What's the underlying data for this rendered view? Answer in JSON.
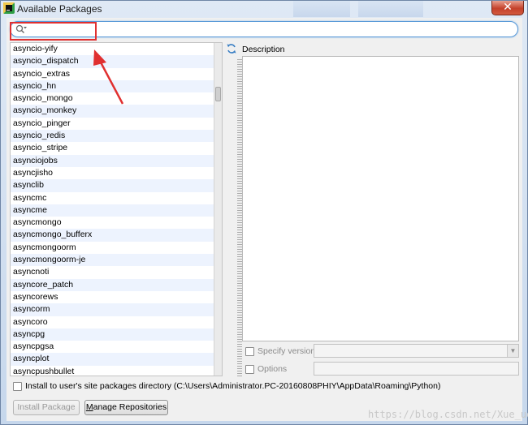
{
  "window": {
    "title": "Available Packages",
    "close_label": "✕"
  },
  "search": {
    "placeholder": "",
    "value": ""
  },
  "packages": [
    "asyncio-yify",
    "asyncio_dispatch",
    "asyncio_extras",
    "asyncio_hn",
    "asyncio_mongo",
    "asyncio_monkey",
    "asyncio_pinger",
    "asyncio_redis",
    "asyncio_stripe",
    "asynciojobs",
    "asyncjisho",
    "asynclib",
    "asyncmc",
    "asyncme",
    "asyncmongo",
    "asyncmongo_bufferx",
    "asyncmongoorm",
    "asyncmongoorm-je",
    "asyncnoti",
    "asyncore_patch",
    "asyncorews",
    "asyncorm",
    "asyncoro",
    "asyncpg",
    "asyncpgsa",
    "asyncplot",
    "asyncpushbullet"
  ],
  "description": {
    "label": "Description",
    "text": ""
  },
  "options": {
    "specify_version_label": "Specify version",
    "specify_version_checked": false,
    "options_label": "Options",
    "options_checked": false
  },
  "install_to_user": {
    "label": "Install to user's site packages directory (C:\\Users\\Administrator.PC-20160808PHIY\\AppData\\Roaming\\Python)",
    "checked": false
  },
  "buttons": {
    "install": "Install Package",
    "manage": "Manage Repositories"
  },
  "watermark": "https://blog.csdn.net/Xue_ue",
  "icons": {
    "app": "pycharm-icon",
    "search": "search-icon",
    "refresh": "refresh-icon"
  },
  "colors": {
    "annotation_red": "#e03030",
    "search_border": "#5a9ad8",
    "list_alt_row": "#edf3fe"
  }
}
